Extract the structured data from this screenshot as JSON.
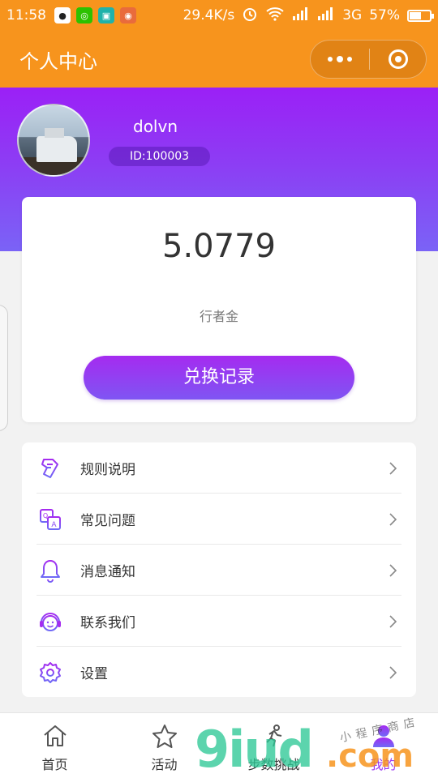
{
  "status_bar": {
    "time": "11:58",
    "network_speed": "29.4K/s",
    "network_type": "3G",
    "battery": "57%",
    "battery_level": 0.57,
    "icons": [
      "qq-icon",
      "wechat-icon",
      "scan-icon",
      "notification-icon",
      "alarm-icon",
      "wifi-icon",
      "signal-icon",
      "battery-icon"
    ]
  },
  "nav": {
    "title": "个人中心"
  },
  "colors": {
    "nav_orange": "#f7941d",
    "header_purple": "#9b20f6",
    "accent_purple": "#7f55f3"
  },
  "profile": {
    "username": "dolvn",
    "id_label": "ID:100003"
  },
  "wallet": {
    "amount": "5.0779",
    "amount_label": "行者金",
    "exchange_button": "兑换记录"
  },
  "menu": {
    "items": [
      {
        "label": "规则说明",
        "icon": "rules-icon"
      },
      {
        "label": "常见问题",
        "icon": "faq-icon"
      },
      {
        "label": "消息通知",
        "icon": "bell-icon"
      },
      {
        "label": "联系我们",
        "icon": "headset-icon"
      },
      {
        "label": "设置",
        "icon": "gear-icon"
      }
    ]
  },
  "tabs": [
    {
      "label": "首页",
      "icon": "home-icon"
    },
    {
      "label": "活动",
      "icon": "star-icon"
    },
    {
      "label": "步数挑战",
      "icon": "runner-icon"
    },
    {
      "label": "我的",
      "icon": "user-icon",
      "active": true
    }
  ],
  "watermark": {
    "brand": "9iud",
    "domain": ".com",
    "tagline": "小程序商店"
  }
}
